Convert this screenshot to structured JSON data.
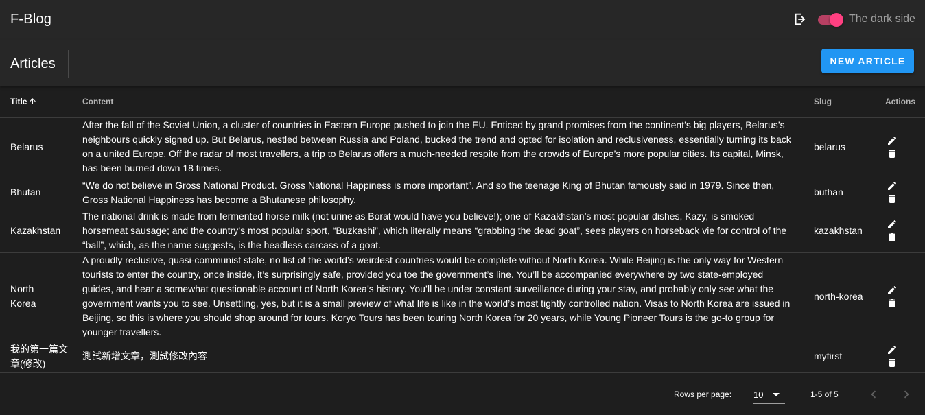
{
  "app": {
    "title": "F-Blog",
    "theme_switch_label": "The dark side",
    "theme_switch_on": true,
    "accent": "#ff4081"
  },
  "toolbar": {
    "title": "Articles",
    "new_button_label": "NEW ARTICLE",
    "new_button_color": "#2196f3"
  },
  "table": {
    "headers": {
      "title": "Title",
      "content": "Content",
      "slug": "Slug",
      "actions": "Actions"
    },
    "sort": {
      "column": "title",
      "direction": "ascending",
      "icon": "arrow-up-icon"
    },
    "rows": [
      {
        "title": "Belarus",
        "content": "After the fall of the Soviet Union, a cluster of countries in Eastern Europe pushed to join the EU. Enticed by grand promises from the continent’s big players, Belarus’s neighbours quickly signed up. But Belarus, nestled between Russia and Poland, bucked the trend and opted for isolation and reclusiveness, essentially turning its back on a united Europe. Off the radar of most travellers, a trip to Belarus offers a much-needed respite from the crowds of Europe’s more popular cities. Its capital, Minsk, has been burned down 18 times.",
        "slug": "belarus"
      },
      {
        "title": "Bhutan",
        "content": "“We do not believe in Gross National Product. Gross National Happiness is more important”. And so the teenage King of Bhutan famously said in 1979. Since then, Gross National Happiness has become a Bhutanese philosophy.",
        "slug": "buthan"
      },
      {
        "title": "Kazakhstan",
        "content": "The national drink is made from fermented horse milk (not urine as Borat would have you believe!); one of Kazakhstan’s most popular dishes, Kazy, is smoked horsemeat sausage; and the country’s most popular sport, “Buzkashi”, which literally means “grabbing the dead goat”, sees players on horseback vie for control of the “ball”, which, as the name suggests, is the headless carcass of a goat.",
        "slug": "kazakhstan"
      },
      {
        "title": "North Korea",
        "content": "A proudly reclusive, quasi-communist state, no list of the world’s weirdest countries would be complete without North Korea. While Beijing is the only way for Western tourists to enter the country, once inside, it’s surprisingly safe, provided you toe the government’s line. You’ll be accompanied everywhere by two state-employed guides, and hear a somewhat questionable account of North Korea’s history. You’ll be under constant surveillance during your stay, and probably only see what the government wants you to see. Unsettling, yes, but it is a small preview of what life is like in the world’s most tightly controlled nation. Visas to North Korea are issued in Beijing, so this is where you should shop around for tours. Koryo Tours has been touring North Korea for 20 years, while Young Pioneer Tours is the go-to group for younger travellers.",
        "slug": "north-korea"
      },
      {
        "title": "我的第一篇文章(修改)",
        "content": "測試新增文章，測試修改內容",
        "slug": "myfirst"
      }
    ],
    "row_actions": [
      "edit-icon",
      "delete-icon"
    ]
  },
  "pagination": {
    "rows_per_page_label": "Rows per page:",
    "rows_per_page": "10",
    "range": "1-5 of 5"
  }
}
